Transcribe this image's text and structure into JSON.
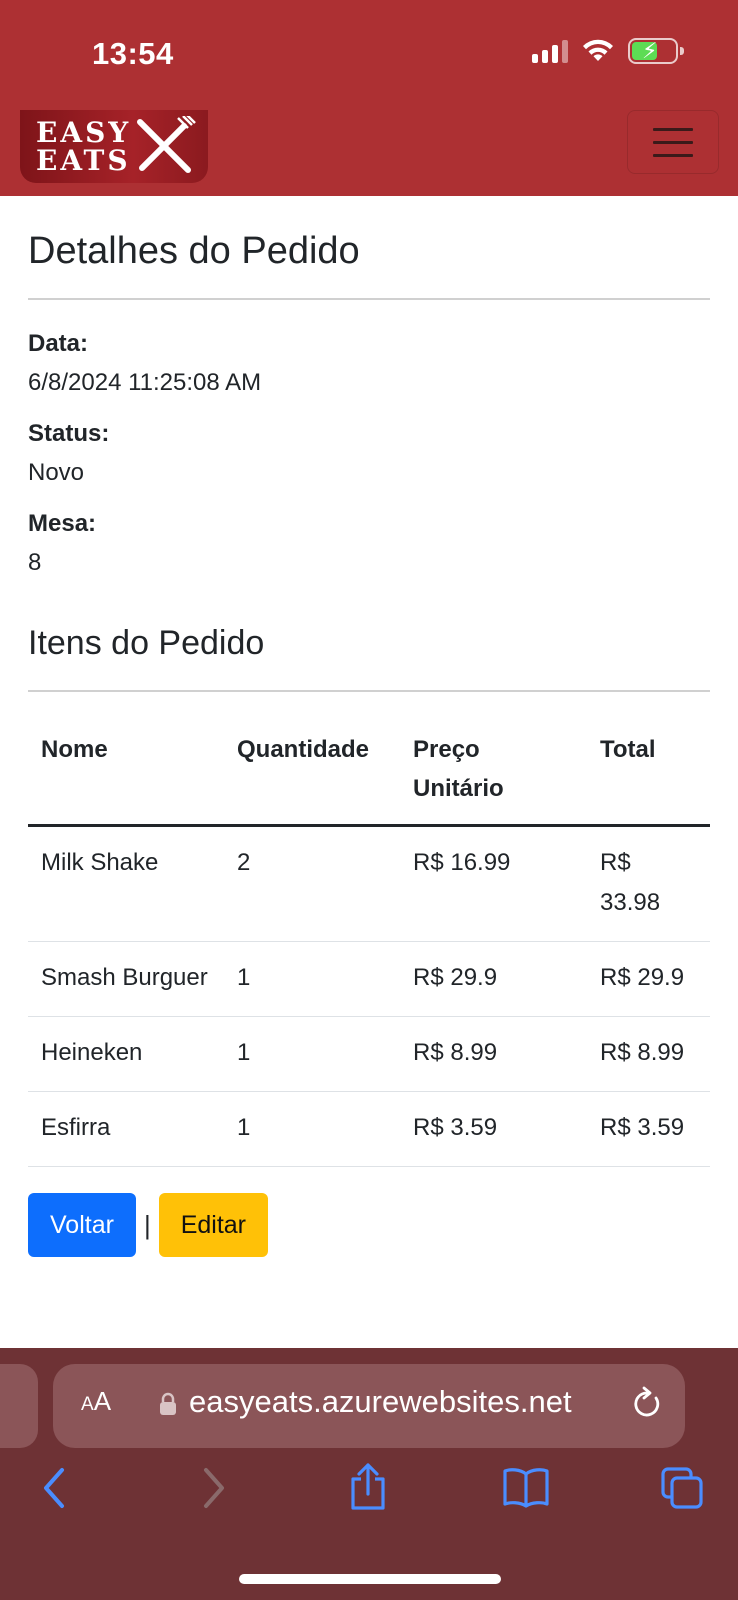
{
  "status_bar": {
    "time": "13:54"
  },
  "navbar": {
    "logo_line1": "EASY",
    "logo_line2": "EATS"
  },
  "page": {
    "title": "Detalhes do Pedido",
    "fields": [
      {
        "label": "Data:",
        "value": "6/8/2024 11:25:08 AM"
      },
      {
        "label": "Status:",
        "value": "Novo"
      },
      {
        "label": "Mesa:",
        "value": "8"
      }
    ],
    "items_title": "Itens do Pedido"
  },
  "table": {
    "headers": [
      "Nome",
      "Quantidade",
      "Preço Unitário",
      "Total"
    ],
    "rows": [
      [
        "Milk Shake",
        "2",
        "R$ 16.99",
        "R$ 33.98"
      ],
      [
        "Smash Burguer",
        "1",
        "R$ 29.9",
        "R$ 29.9"
      ],
      [
        "Heineken",
        "1",
        "R$ 8.99",
        "R$ 8.99"
      ],
      [
        "Esfirra",
        "1",
        "R$ 3.59",
        "R$ 3.59"
      ]
    ]
  },
  "actions": {
    "back_label": "Voltar",
    "separator": "|",
    "edit_label": "Editar"
  },
  "browser": {
    "aa_small": "A",
    "aa_large": "A",
    "url": "easyeats.azurewebsites.net"
  },
  "colors": {
    "brand_red": "#ad3033",
    "primary": "#0d6efd",
    "warning": "#ffc107",
    "safari_bar": "#6e3235"
  },
  "icons": [
    "signal-icon",
    "wifi-icon",
    "battery-charging-icon",
    "fork-knife-icon",
    "hamburger-menu-icon",
    "lock-icon",
    "reload-icon",
    "back-arrow-icon",
    "forward-arrow-icon",
    "share-icon",
    "bookmarks-icon",
    "tabs-icon"
  ]
}
